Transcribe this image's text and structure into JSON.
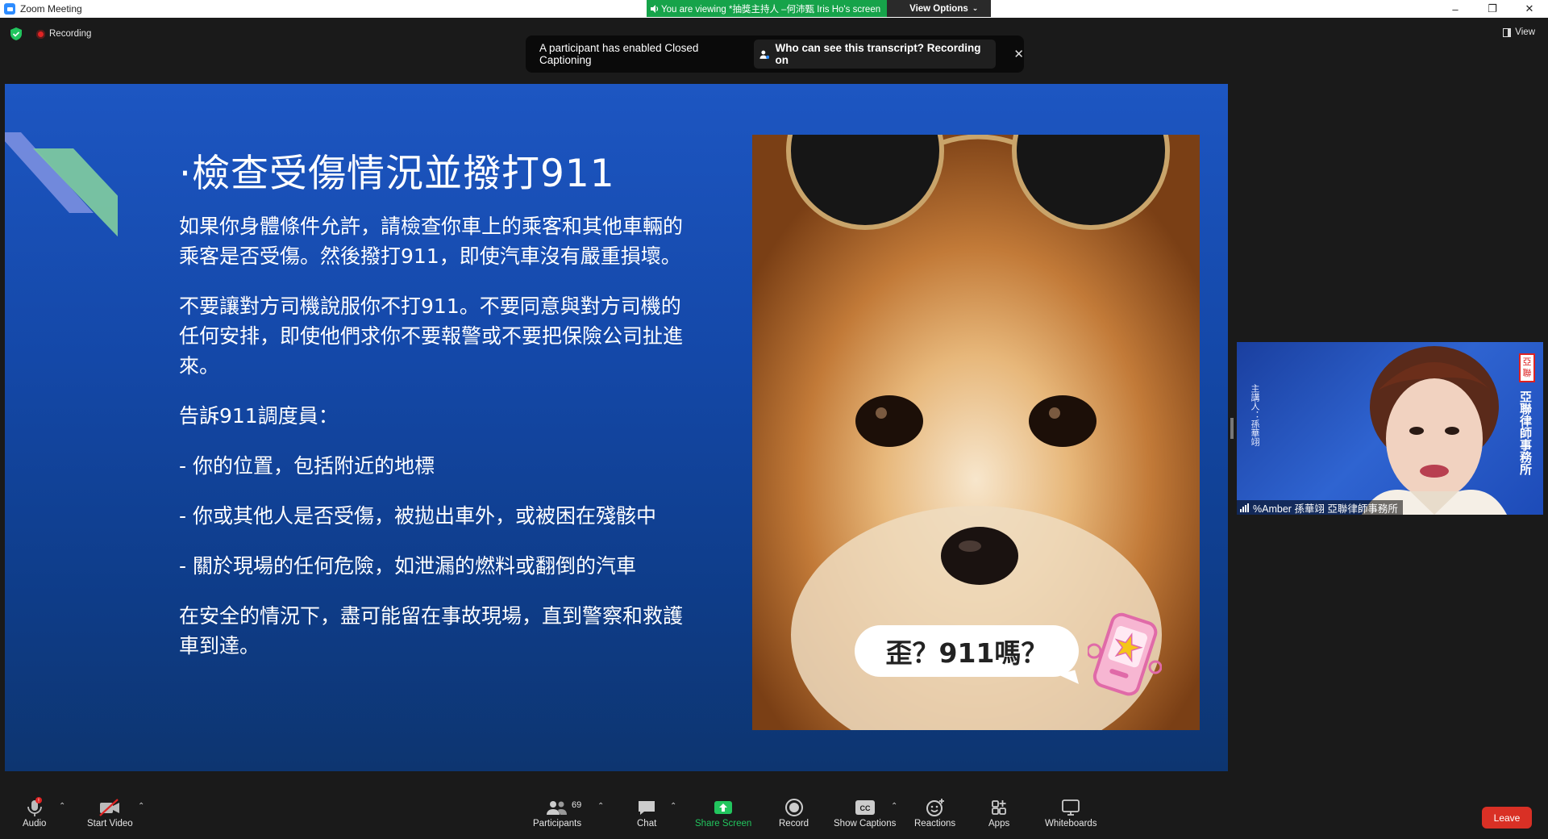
{
  "window": {
    "title": "Zoom Meeting",
    "controls": [
      "–",
      "❐",
      "✕"
    ]
  },
  "banner": {
    "viewing_text": "You are viewing *抽獎主持人 –何沛甄 Iris Ho's screen",
    "view_options": "View Options"
  },
  "status": {
    "recording": "Recording",
    "view": "View"
  },
  "caption_notice": {
    "message": "A participant has enabled Closed Captioning",
    "link": "Who can see this transcript? Recording on",
    "close": "✕"
  },
  "slide": {
    "title": "·檢查受傷情況並撥打911",
    "paragraphs": [
      "如果你身體條件允許，請檢查你車上的乘客和其他車輛的乘客是否受傷。然後撥打911，即使汽車沒有嚴重損壞。",
      "不要讓對方司機說服你不打911。不要同意與對方司機的任何安排，即使他們求你不要報警或不要把保險公司扯進來。",
      "告訴911調度員：",
      "- 你的位置，包括附近的地標",
      "- 你或其他人是否受傷，被拋出車外，或被困在殘骸中",
      "- 關於現場的任何危險，如泄漏的燃料或翻倒的汽車",
      "在安全的情況下，盡可能留在事故現場，直到警察和救護車到達。"
    ],
    "bubble_text": "歪？911嗎？"
  },
  "participant_video": {
    "name": "%Amber 孫華翊 亞聯律師事務所",
    "side_left": "主講人：孫華翊",
    "side_right": "亞聯律師事務所",
    "seal": "亞聯"
  },
  "toolbar": {
    "audio": "Audio",
    "start_video": "Start Video",
    "participants": "Participants",
    "participants_count": "69",
    "chat": "Chat",
    "share_screen": "Share Screen",
    "record": "Record",
    "show_captions": "Show Captions",
    "reactions": "Reactions",
    "apps": "Apps",
    "whiteboards": "Whiteboards",
    "leave": "Leave"
  },
  "colors": {
    "accent_green": "#16a34a",
    "leave_red": "#d93025",
    "slide_blue": "#1d56c2"
  }
}
